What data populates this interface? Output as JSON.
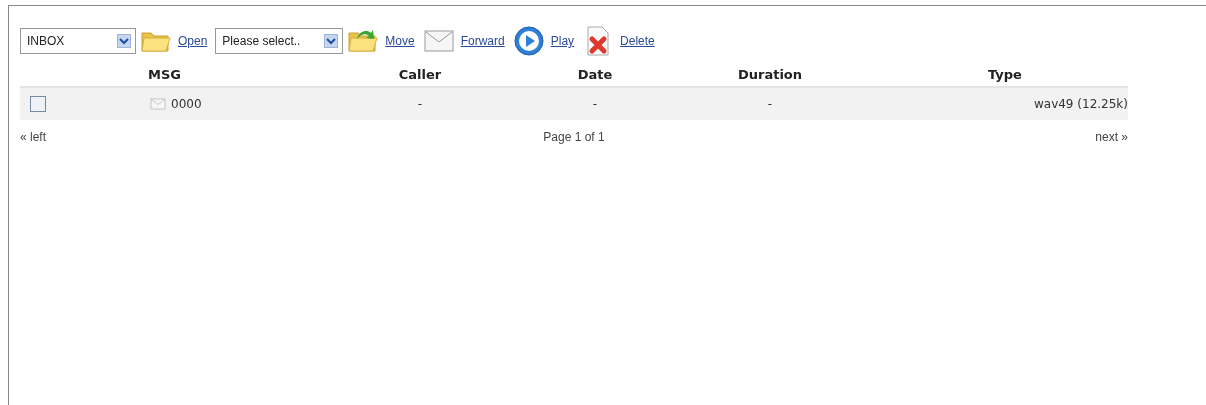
{
  "toolbar": [
    {
      "kind": "select",
      "value": "INBOX"
    },
    {
      "kind": "open",
      "label": "Open"
    },
    {
      "kind": "select",
      "value": "Please select.."
    },
    {
      "kind": "move",
      "label": "Move"
    },
    {
      "kind": "forward",
      "label": "Forward"
    },
    {
      "kind": "play",
      "label": "Play"
    },
    {
      "kind": "delete",
      "label": "Delete"
    }
  ],
  "table": {
    "columns": [
      "MSG",
      "Caller",
      "Date",
      "Duration",
      "Type"
    ],
    "rows": [
      {
        "checked": false,
        "msg": "0000",
        "caller": "-",
        "date": "-",
        "duration": "-",
        "type": "wav49 (12.25k)"
      }
    ]
  },
  "pager": {
    "prev": "« left",
    "page": "Page 1 of 1",
    "next": "next »"
  }
}
